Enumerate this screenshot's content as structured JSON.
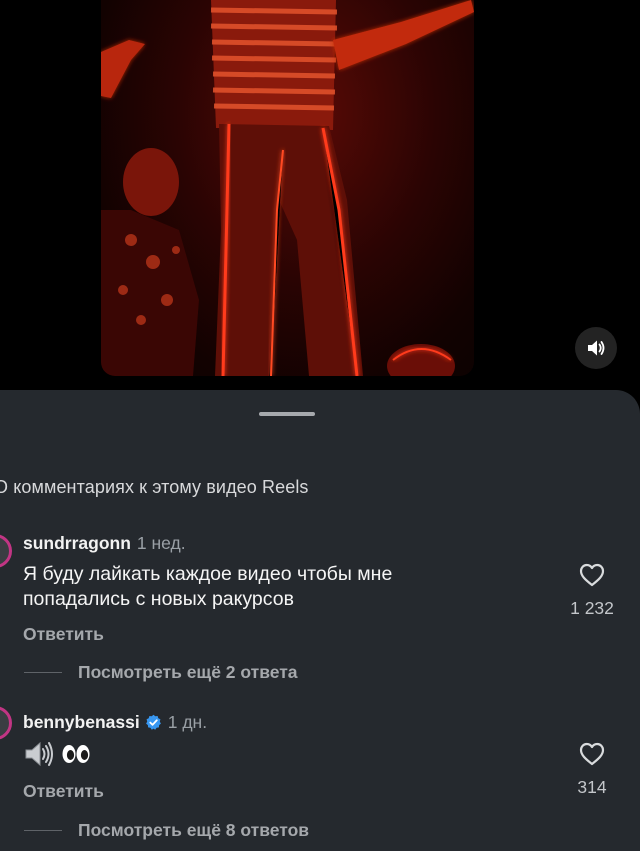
{
  "sheet": {
    "title": "О комментариях к этому видео Reels"
  },
  "comments": [
    {
      "username": "sundrragonn",
      "time": "1 нед.",
      "text": "Я буду лайкать каждое видео чтобы мне попадались с новых ракурсов",
      "reply_label": "Ответить",
      "likes": "1 232",
      "more_replies": "Посмотреть ещё 2 ответа"
    },
    {
      "username": "bennybenassi",
      "verified": true,
      "time": "1 дн.",
      "text_emojis": [
        "speaker-icon",
        "eyes-icon"
      ],
      "reply_label": "Ответить",
      "likes": "314",
      "more_replies": "Посмотреть ещё 8 ответов"
    }
  ],
  "colors": {
    "sheet_bg": "#25292e",
    "avatar_ring": "#c13584",
    "verified": "#3897f0",
    "video_glow": "#ff2a12"
  }
}
